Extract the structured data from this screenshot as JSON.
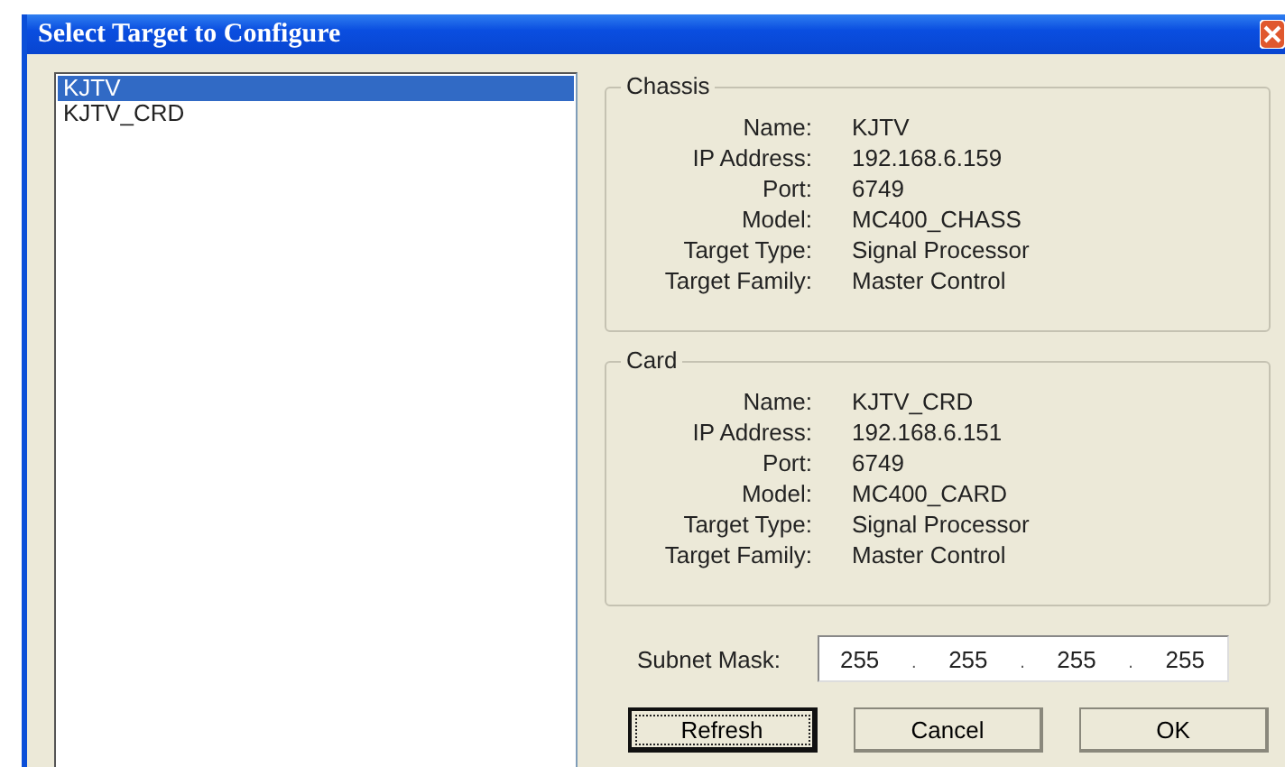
{
  "window": {
    "title": "Select Target to Configure"
  },
  "targets": [
    {
      "label": "KJTV",
      "selected": true
    },
    {
      "label": "KJTV_CRD",
      "selected": false
    }
  ],
  "groups": [
    {
      "title": "Chassis",
      "fields": [
        {
          "label": "Name:",
          "value": "KJTV"
        },
        {
          "label": "IP Address:",
          "value": "192.168.6.159"
        },
        {
          "label": "Port:",
          "value": "6749"
        },
        {
          "label": "Model:",
          "value": "MC400_CHASS"
        },
        {
          "label": "Target Type:",
          "value": "Signal Processor"
        },
        {
          "label": "Target Family:",
          "value": "Master Control"
        }
      ]
    },
    {
      "title": "Card",
      "fields": [
        {
          "label": "Name:",
          "value": "KJTV_CRD"
        },
        {
          "label": "IP Address:",
          "value": "192.168.6.151"
        },
        {
          "label": "Port:",
          "value": "6749"
        },
        {
          "label": "Model:",
          "value": "MC400_CARD"
        },
        {
          "label": "Target Type:",
          "value": "Signal Processor"
        },
        {
          "label": "Target Family:",
          "value": "Master Control"
        }
      ]
    }
  ],
  "subnet_mask": {
    "label": "Subnet Mask:",
    "segments": [
      {
        "kind": "octet",
        "text": "255"
      },
      {
        "kind": "dot",
        "text": "."
      },
      {
        "kind": "octet",
        "text": "255"
      },
      {
        "kind": "dot",
        "text": "."
      },
      {
        "kind": "octet",
        "text": "255"
      },
      {
        "kind": "dot",
        "text": "."
      },
      {
        "kind": "octet",
        "text": "255"
      }
    ]
  },
  "buttons": [
    {
      "label": "Refresh",
      "focused": true
    },
    {
      "label": "Cancel",
      "focused": false
    },
    {
      "label": "OK",
      "focused": false
    }
  ]
}
